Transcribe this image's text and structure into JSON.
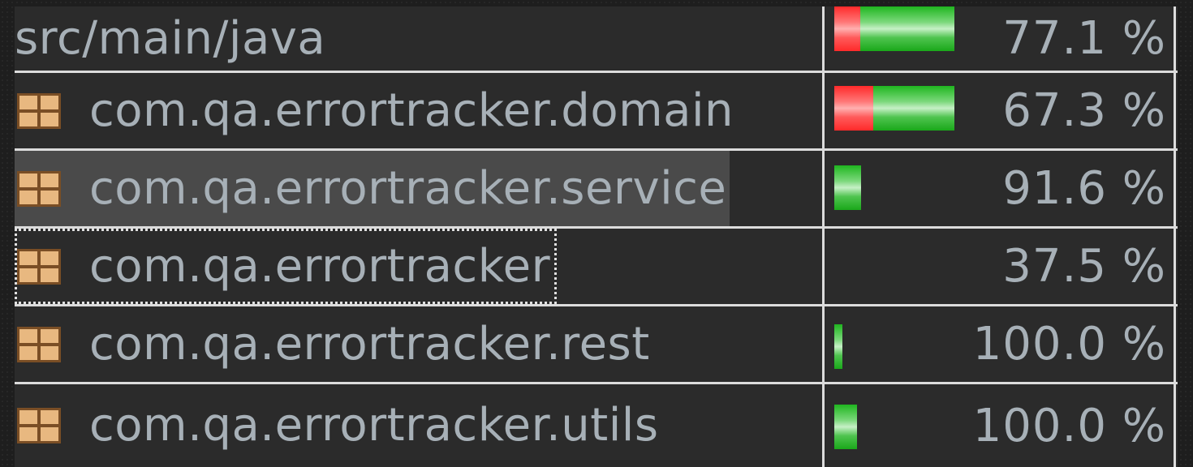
{
  "rows": [
    {
      "name": "src/main/java",
      "coverage": "77.1 %",
      "covered_fraction": 0.771,
      "type": "root"
    },
    {
      "name": "com.qa.errortracker.domain",
      "coverage": "67.3 %",
      "covered_fraction": 0.673,
      "type": "package"
    },
    {
      "name": "com.qa.errortracker.service",
      "coverage": "91.6 %",
      "covered_fraction": 0.916,
      "type": "package",
      "state": "hovered"
    },
    {
      "name": "com.qa.errortracker",
      "coverage": "37.5 %",
      "covered_fraction": 0.375,
      "type": "package",
      "state": "focused"
    },
    {
      "name": "com.qa.errortracker.rest",
      "coverage": "100.0 %",
      "covered_fraction": 1.0,
      "type": "package"
    },
    {
      "name": "com.qa.errortracker.utils",
      "coverage": "100.0 %",
      "covered_fraction": 1.0,
      "type": "package"
    }
  ],
  "icons": {
    "package": "package-icon"
  },
  "colors": {
    "covered": "#2db82d",
    "missed": "#ff3030",
    "text": "#a7b0b7",
    "grid": "#dcdcdc",
    "background": "#2b2b2b"
  }
}
